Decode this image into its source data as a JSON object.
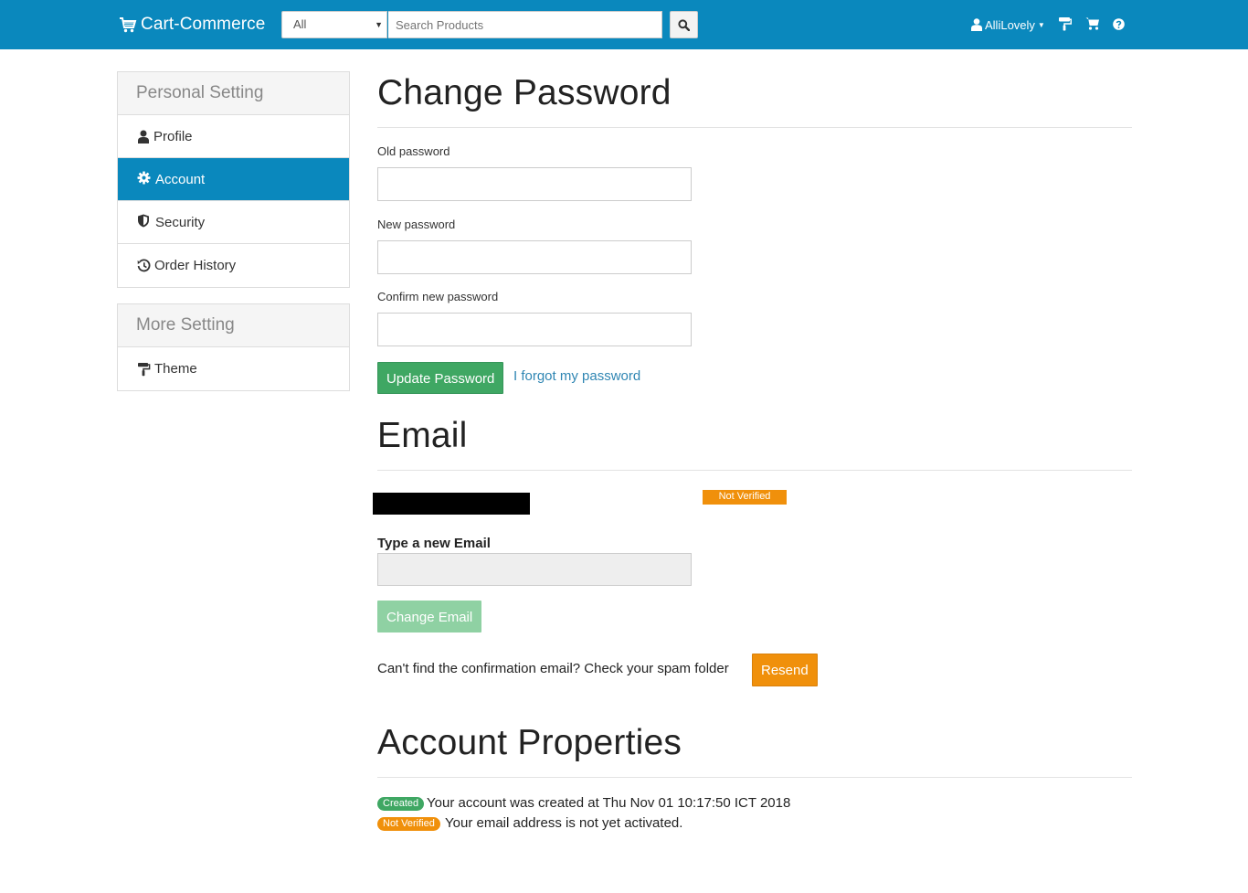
{
  "navbar": {
    "brand": "Cart-Commerce",
    "category_select": "All",
    "search_placeholder": "Search Products",
    "user_name": "AlliLovely",
    "icons": [
      "cart-logo-icon",
      "search-icon",
      "user-icon",
      "paint-roller-icon",
      "cart-icon",
      "help-icon"
    ],
    "accent_color": "#0a88bd"
  },
  "sidebar": {
    "personal_heading": "Personal Setting",
    "personal_items": [
      {
        "label": "Profile",
        "icon": "user-icon"
      },
      {
        "label": "Account",
        "icon": "gear-icon",
        "active": true
      },
      {
        "label": "Security",
        "icon": "shield-icon"
      },
      {
        "label": "Order History",
        "icon": "history-icon"
      }
    ],
    "more_heading": "More Setting",
    "more_items": [
      {
        "label": "Theme",
        "icon": "paint-roller-icon"
      }
    ]
  },
  "password": {
    "title": "Change Password",
    "old_label": "Old password",
    "new_label": "New password",
    "confirm_label": "Confirm new password",
    "old_value": "",
    "new_value": "",
    "confirm_value": "",
    "update_button": "Update Password",
    "forgot_link": "I forgot my password"
  },
  "email": {
    "title": "Email",
    "status_badge": "Not Verified",
    "new_email_label": "Type a new Email",
    "new_email_value": "",
    "change_button": "Change Email",
    "spam_note": "Can't find the confirmation email? Check your spam folder",
    "resend_button": "Resend"
  },
  "account_properties": {
    "title": "Account Properties",
    "rows": [
      {
        "badge": "Created",
        "text": "Your account was created at Thu Nov 01 10:17:50 ICT 2018",
        "color": "#3fa763"
      },
      {
        "badge": "Not Verified",
        "text": "Your email address is not yet activated.",
        "color": "#f0900b"
      }
    ]
  }
}
